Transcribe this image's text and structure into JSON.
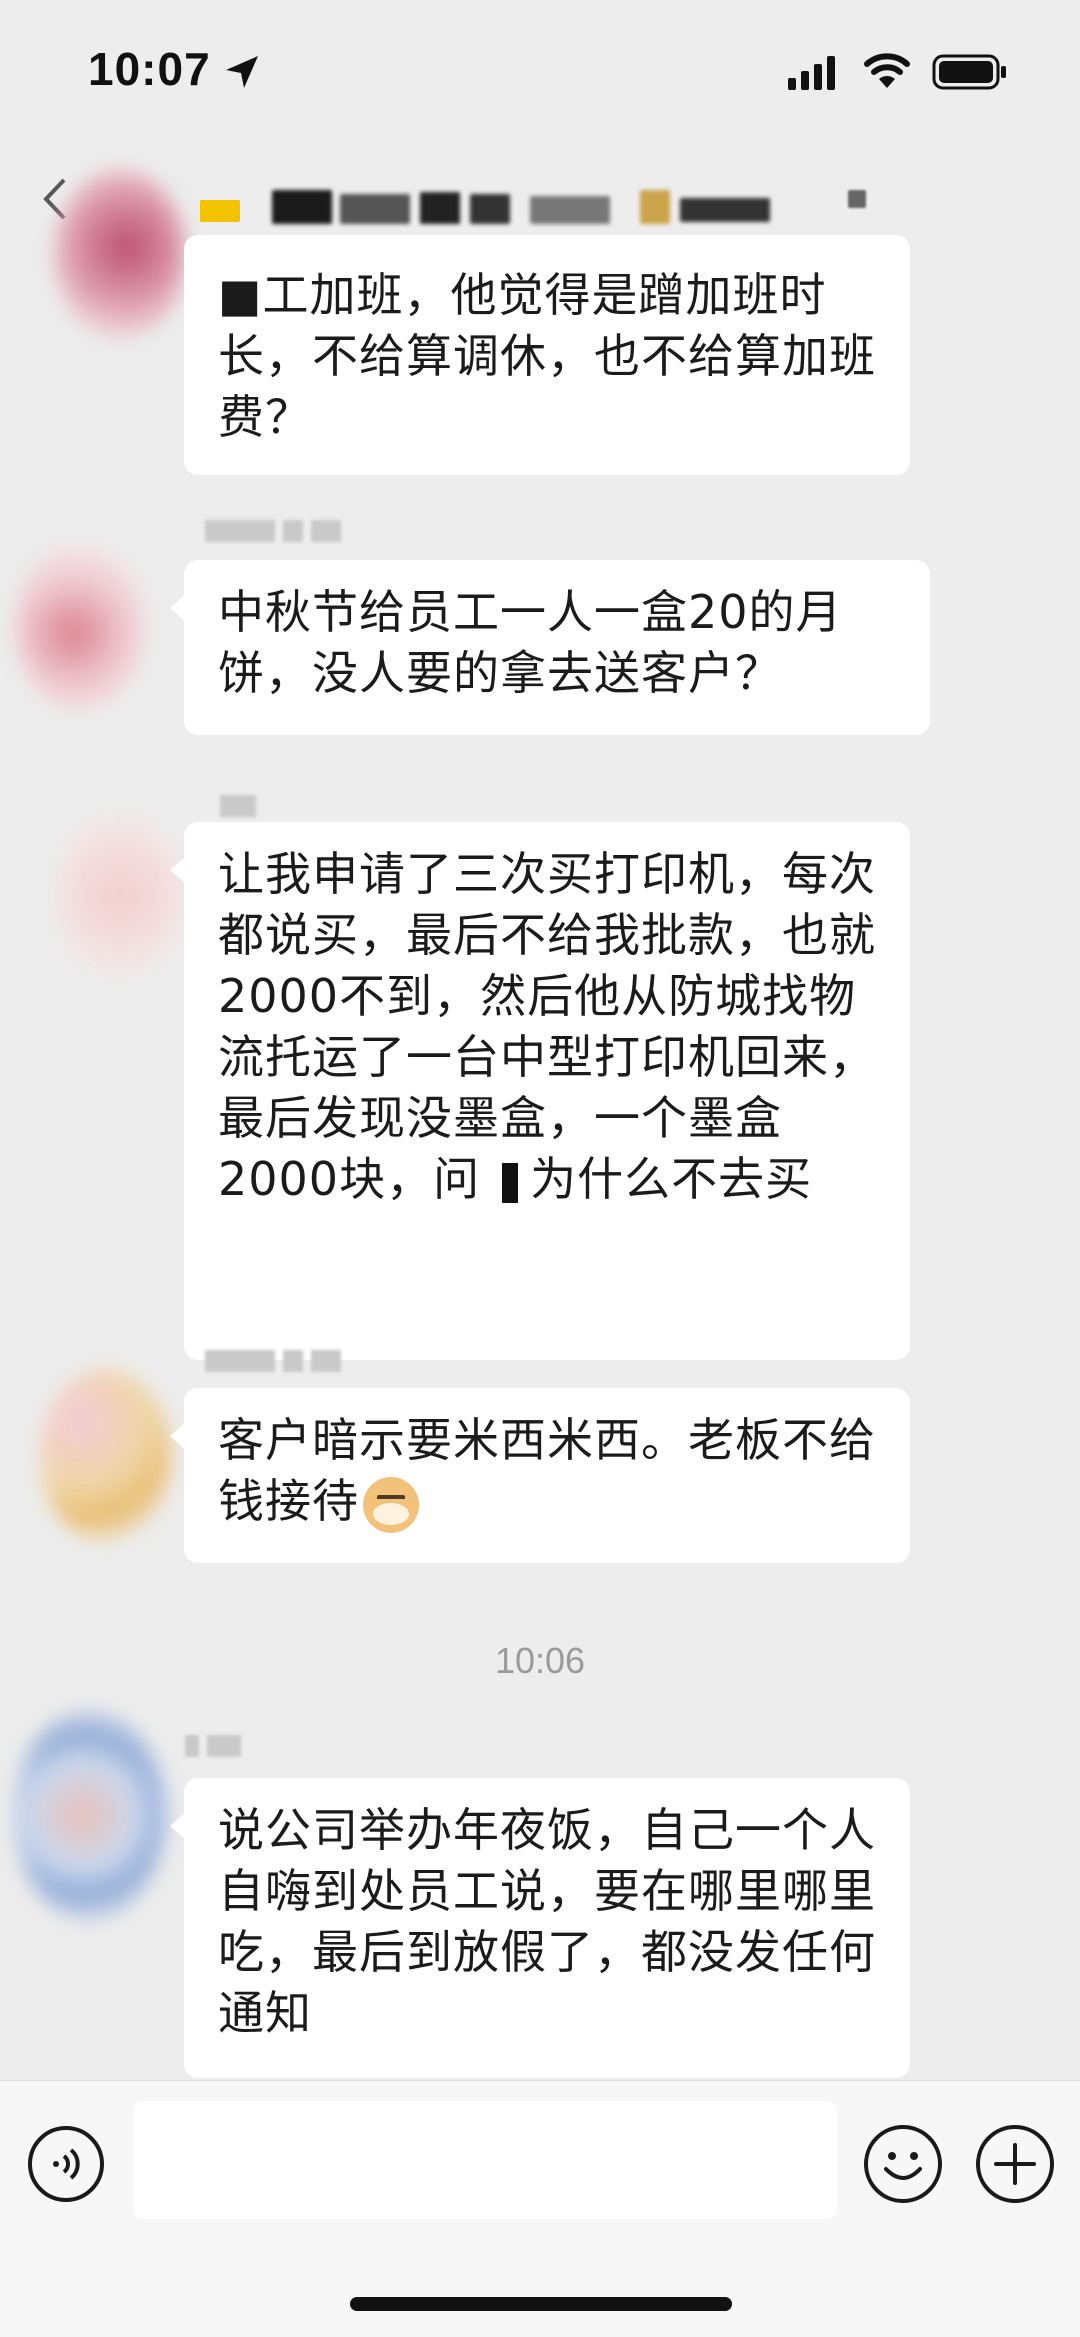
{
  "status_bar": {
    "time": "10:07"
  },
  "colors": {
    "background": "#ededed",
    "bubble": "#ffffff",
    "text": "#1b1b1b",
    "timestamp": "#9a9a9a"
  },
  "messages": [
    {
      "text": "■工加班，他觉得是蹭加班时长，不给算调休，也不给算加班费？"
    },
    {
      "text": "中秋节给员工一人一盒20的月饼，没人要的拿去送客户？"
    },
    {
      "text_before": "让我申请了三次买打印机，每次都说买，最后不给我批款，也就2000不到，然后他从防城找物流托运了一台中型打印机回来，最后发现没墨盒，一个墨盒2000块，问",
      "text_after": "为什么不去买"
    },
    {
      "text": "客户暗示要米西米西。老板不给钱接待",
      "emoji": "doge-emoji"
    }
  ],
  "time_divider": "10:06",
  "last_message": {
    "text": "说公司举办年夜饭，自己一个人自嗨到处员工说，要在哪里哪里吃，最后到放假了，都没发任何通知"
  },
  "input_bar": {
    "voice_icon": "voice-icon",
    "emoji_icon": "smiley-icon",
    "plus_icon": "plus-icon"
  }
}
